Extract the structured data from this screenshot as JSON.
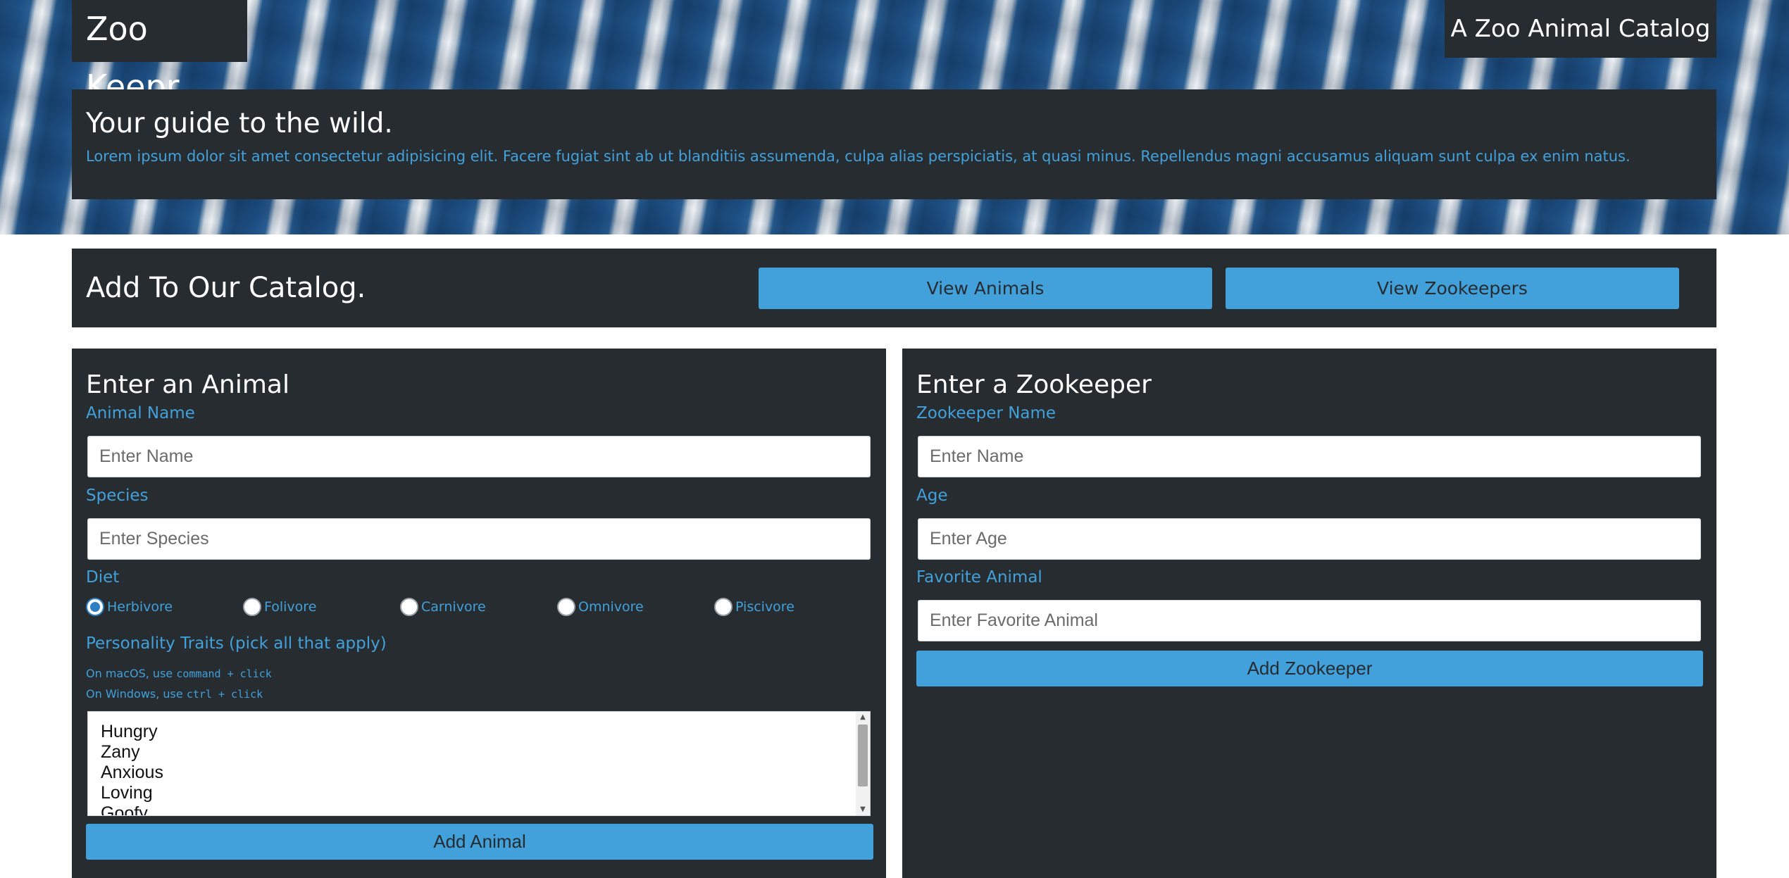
{
  "header": {
    "brand": "Zoo Keepr",
    "tagline": "A Zoo Animal Catalog",
    "intro_title": "Your guide to the wild.",
    "intro_text": "Lorem ipsum dolor sit amet consectetur adipisicing elit. Facere fugiat sint ab ut blanditiis assumenda, culpa alias perspiciatis, at quasi minus. Repellendus magni accusamus aliquam sunt culpa ex enim natus."
  },
  "catalog": {
    "title": "Add To Our Catalog.",
    "view_animals": "View Animals",
    "view_zookeepers": "View Zookeepers"
  },
  "animal_form": {
    "title": "Enter an Animal",
    "name_label": "Animal Name",
    "name_placeholder": "Enter Name",
    "species_label": "Species",
    "species_placeholder": "Enter Species",
    "diet_label": "Diet",
    "diet_options": [
      "Herbivore",
      "Folivore",
      "Carnivore",
      "Omnivore",
      "Piscivore"
    ],
    "diet_selected": "Herbivore",
    "traits_label": "Personality Traits (pick all that apply)",
    "hint_mac_prefix": "On macOS, use ",
    "hint_mac_code": "command + click",
    "hint_win_prefix": "On Windows, use ",
    "hint_win_code": "ctrl + click",
    "traits": [
      "Hungry",
      "Zany",
      "Anxious",
      "Loving",
      "Goofy"
    ],
    "submit": "Add Animal"
  },
  "zookeeper_form": {
    "title": "Enter a Zookeeper",
    "name_label": "Zookeeper Name",
    "name_placeholder": "Enter Name",
    "age_label": "Age",
    "age_placeholder": "Enter Age",
    "favorite_label": "Favorite Animal",
    "favorite_placeholder": "Enter Favorite Animal",
    "submit": "Add Zookeeper"
  },
  "colors": {
    "panel": "#262c30",
    "accent": "#42a0db"
  },
  "icons": {
    "scroll_up": "scroll-up-arrow-icon",
    "scroll_down": "scroll-down-arrow-icon"
  }
}
